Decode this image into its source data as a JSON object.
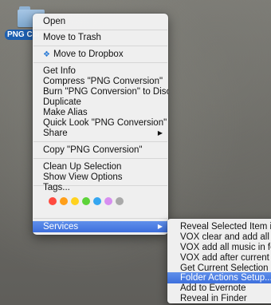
{
  "desktop": {
    "folder_label": "PNG Conv"
  },
  "menu": {
    "open": "Open",
    "move_to_trash": "Move to Trash",
    "move_to_dropbox": "Move to Dropbox",
    "get_info": "Get Info",
    "compress": "Compress \"PNG Conversion\"",
    "burn": "Burn \"PNG Conversion\" to Disc...",
    "duplicate": "Duplicate",
    "make_alias": "Make Alias",
    "quick_look": "Quick Look \"PNG Conversion\"",
    "share": "Share",
    "copy": "Copy \"PNG Conversion\"",
    "clean_up": "Clean Up Selection",
    "show_view_options": "Show View Options",
    "tags": "Tags...",
    "services": "Services",
    "submenu_arrow": "▶"
  },
  "tag_colors": [
    "#ff4a3f",
    "#ff9f1a",
    "#ffd21f",
    "#5dd339",
    "#35a6f0",
    "#d78ef0",
    "#a9a9a9"
  ],
  "services_submenu": [
    "Reveal Selected Item in Ra",
    "VOX clear and add all music",
    "VOX add all music in folde",
    "VOX add after current all r",
    "Get Current Selection (Do",
    "Folder Actions Setup...",
    "Add to Evernote",
    "Reveal in Finder"
  ],
  "colors": {
    "selection": "#3d6fdd",
    "dropbox": "#2b7bd6",
    "folder_label_bg": "#1d5fb0"
  }
}
